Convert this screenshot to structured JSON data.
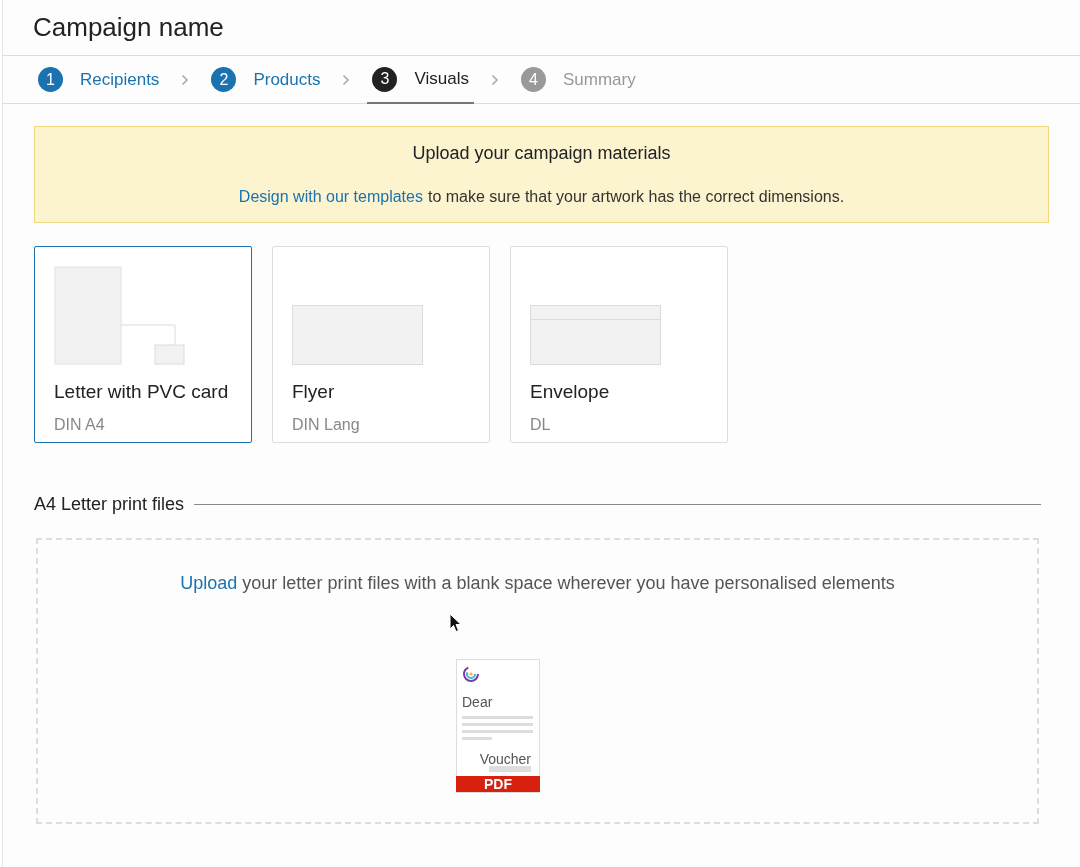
{
  "header": {
    "title": "Campaign name"
  },
  "steps": [
    {
      "number": "1",
      "label": "Recipients",
      "selected": false,
      "completed": true
    },
    {
      "number": "2",
      "label": "Products",
      "selected": false,
      "completed": true
    },
    {
      "number": "3",
      "label": "Visuals",
      "selected": true,
      "completed": false
    },
    {
      "number": "4",
      "label": "Summary",
      "selected": false,
      "completed": false
    }
  ],
  "banner": {
    "title": "Upload your campaign materials",
    "link": "Design with our templates",
    "text": "to make sure that your artwork has the correct dimensions."
  },
  "products": [
    {
      "kind": "letter-card",
      "title": "Letter with PVC card",
      "subtitle": "DIN A4",
      "selected": true
    },
    {
      "kind": "flyer",
      "title": "Flyer",
      "subtitle": "DIN Lang",
      "selected": false
    },
    {
      "kind": "envelope",
      "title": "Envelope",
      "subtitle": "DL",
      "selected": false
    }
  ],
  "print_files": {
    "heading": "A4 Letter print files",
    "link": "Upload",
    "text": "your letter print files with a blank space wherever you have personalised elements",
    "sample": {
      "greeting": "Dear",
      "voucher": "Voucher",
      "badge": "PDF"
    }
  }
}
